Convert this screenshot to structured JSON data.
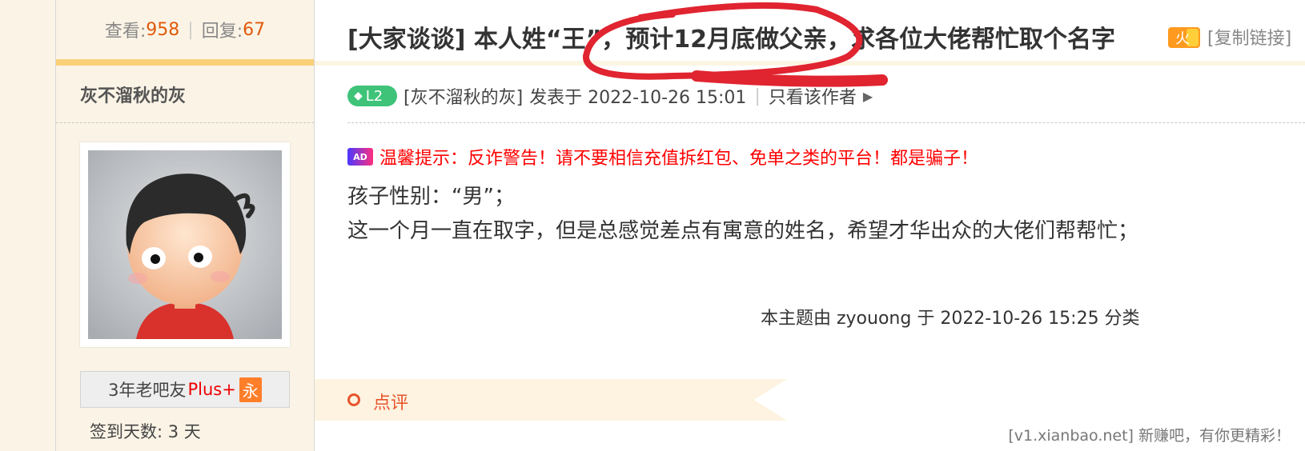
{
  "stats": {
    "views_label": "查看:",
    "views": "958",
    "replies_label": "回复:",
    "replies": "67"
  },
  "sidebar": {
    "username": "灰不溜秋的灰",
    "badge_text": "3年老吧友",
    "badge_plus": "Plus+",
    "badge_yong": "永",
    "signin": "签到天数: 3 天"
  },
  "post": {
    "title": "[大家谈谈] 本人姓“王”，预计12月底做父亲，求各位大佬帮忙取个名字",
    "copy_link": "[复制链接]",
    "level": "L2",
    "author_bracket": "[灰不溜秋的灰]",
    "posted_prefix": "发表于 2022-10-26 15:01",
    "only_author": "只看该作者",
    "ad_text": "温馨提示：反诈警告！请不要相信充值拆红包、免单之类的平台！都是骗子！",
    "ad_icon": "AD",
    "body_line1": "孩子性别：“男”；",
    "body_line2": "这一个月一直在取字，但是总感觉差点有寓意的姓名，希望才华出众的大佬们帮帮忙；",
    "mod_note": "本主题由 zyouong 于 2022-10-26 15:25 分类",
    "comment_label": "点评"
  },
  "hot_icon_text": "火",
  "footer": "[v1.xianbao.net] 新赚吧，有你更精彩！",
  "colors": {
    "accent_orange": "#e05a0c",
    "ad_red": "#ff0000",
    "level_green": "#3ec378",
    "sidebar_bg": "#fbf4e6"
  }
}
